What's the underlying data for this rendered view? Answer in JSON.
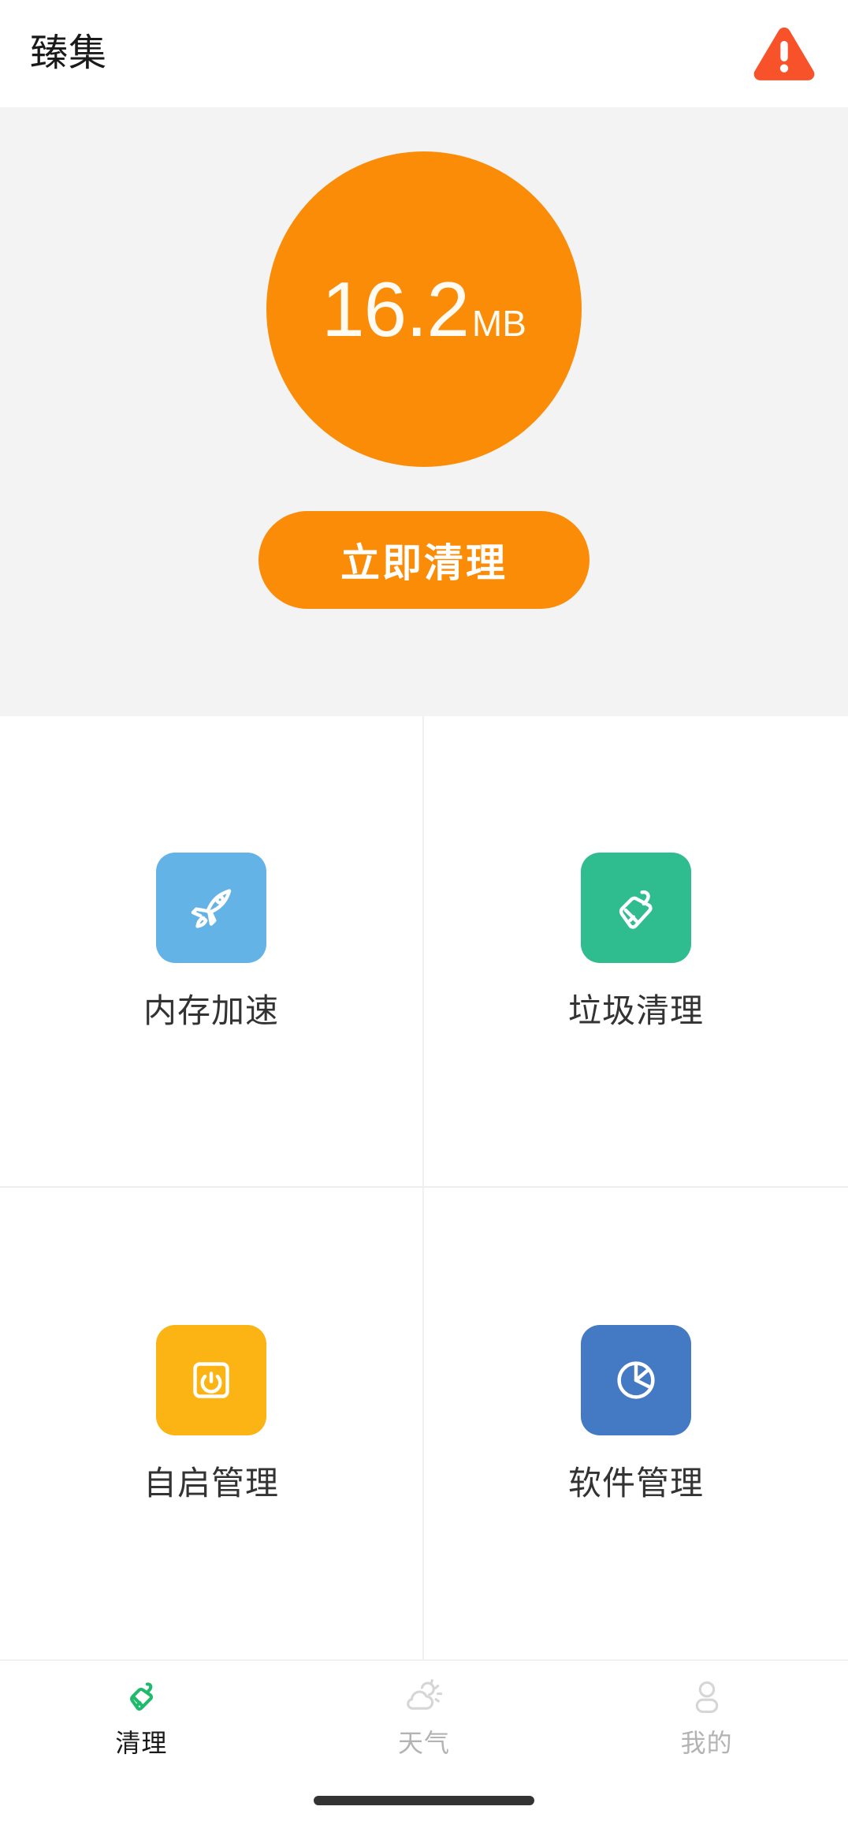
{
  "header": {
    "title": "臻集",
    "warning_icon": "warning-triangle-icon",
    "warning_color": "#f8522a"
  },
  "hero": {
    "background": "#f3f3f3",
    "accent_color": "#fa8c08",
    "gauge": {
      "value": "16.2",
      "unit": "MB",
      "icon": "storage-gauge-circle"
    },
    "clean_button": {
      "label": "立即清理"
    }
  },
  "features": [
    {
      "label": "内存加速",
      "icon": "rocket-icon",
      "color": "#63b3e6"
    },
    {
      "label": "垃圾清理",
      "icon": "broom-icon",
      "color": "#2fbd8f"
    },
    {
      "label": "自启管理",
      "icon": "power-icon",
      "color": "#fcb415"
    },
    {
      "label": "软件管理",
      "icon": "pie-chart-icon",
      "color": "#4479c4"
    }
  ],
  "tabbar": {
    "items": [
      {
        "label": "清理",
        "icon": "broom-icon",
        "active": true,
        "color": "#20ba6d"
      },
      {
        "label": "天气",
        "icon": "cloud-sun-icon",
        "active": false,
        "color": "#d6d6d6"
      },
      {
        "label": "我的",
        "icon": "person-icon",
        "active": false,
        "color": "#d6d6d6"
      }
    ]
  }
}
